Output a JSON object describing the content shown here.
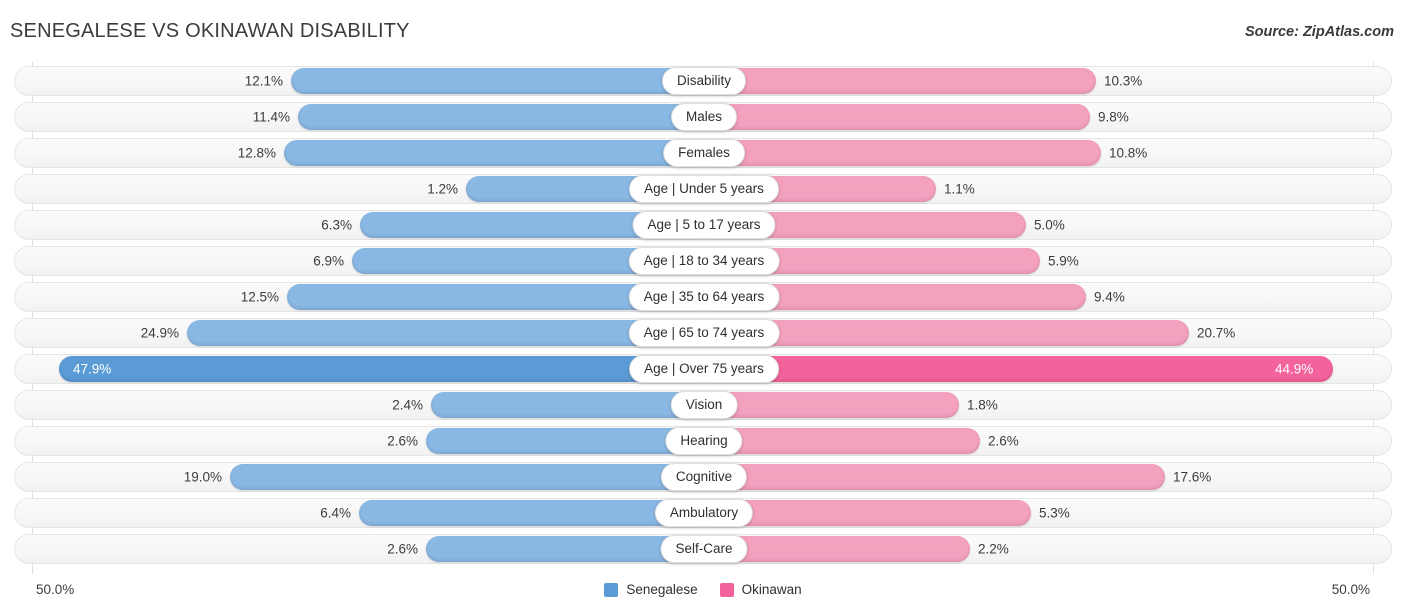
{
  "header": {
    "title": "SENEGALESE VS OKINAWAN DISABILITY",
    "source": "Source: ZipAtlas.com"
  },
  "axis": {
    "left_tick": "50.0%",
    "right_tick": "50.0%",
    "max": 50.0
  },
  "legend": {
    "items": [
      {
        "label": "Senegalese",
        "color": "#5b9bd5"
      },
      {
        "label": "Okinawan",
        "color": "#f4629c"
      }
    ]
  },
  "colors": {
    "left_light": "#8ab8e4",
    "left_dark": "#5b9bd5",
    "right_light": "#f4a0bf",
    "right_dark": "#f4629c",
    "row_bg": "#f7f7f7",
    "text": "#3c3c3c"
  },
  "chart_data": {
    "type": "bar",
    "title": "SENEGALESE VS OKINAWAN DISABILITY",
    "subtitle": "Source: ZipAtlas.com",
    "orientation": "horizontal-diverging",
    "xlabel": "",
    "ylabel": "",
    "xlim": [
      -50.0,
      50.0
    ],
    "grid": false,
    "legend_position": "bottom-center",
    "categories": [
      "Disability",
      "Males",
      "Females",
      "Age | Under 5 years",
      "Age | 5 to 17 years",
      "Age | 18 to 34 years",
      "Age | 35 to 64 years",
      "Age | 65 to 74 years",
      "Age | Over 75 years",
      "Vision",
      "Hearing",
      "Cognitive",
      "Ambulatory",
      "Self-Care"
    ],
    "series": [
      {
        "name": "Senegalese",
        "values": [
          12.1,
          11.4,
          12.8,
          1.2,
          6.3,
          6.9,
          12.5,
          24.9,
          47.9,
          2.4,
          2.6,
          19.0,
          6.4,
          2.6
        ],
        "labels": [
          "12.1%",
          "11.4%",
          "12.8%",
          "1.2%",
          "6.3%",
          "6.9%",
          "12.5%",
          "24.9%",
          "47.9%",
          "2.4%",
          "2.6%",
          "19.0%",
          "6.4%",
          "2.6%"
        ]
      },
      {
        "name": "Okinawan",
        "values": [
          10.3,
          9.8,
          10.8,
          1.1,
          5.0,
          5.9,
          9.4,
          20.7,
          44.9,
          1.8,
          2.6,
          17.6,
          5.3,
          2.2
        ],
        "labels": [
          "10.3%",
          "9.8%",
          "10.8%",
          "1.1%",
          "5.0%",
          "5.9%",
          "9.4%",
          "20.7%",
          "44.9%",
          "1.8%",
          "2.6%",
          "17.6%",
          "5.3%",
          "2.2%"
        ]
      }
    ]
  },
  "rows": [
    {
      "label": "Disability",
      "left": "12.1%",
      "right": "10.3%",
      "left_val": 12.1,
      "right_val": 10.3,
      "highlight": false
    },
    {
      "label": "Males",
      "left": "11.4%",
      "right": "9.8%",
      "left_val": 11.4,
      "right_val": 9.8,
      "highlight": false
    },
    {
      "label": "Females",
      "left": "12.8%",
      "right": "10.8%",
      "left_val": 12.8,
      "right_val": 10.8,
      "highlight": false
    },
    {
      "label": "Age | Under 5 years",
      "left": "1.2%",
      "right": "1.1%",
      "left_val": 1.2,
      "right_val": 1.1,
      "highlight": false
    },
    {
      "label": "Age | 5 to 17 years",
      "left": "6.3%",
      "right": "5.0%",
      "left_val": 6.3,
      "right_val": 5.0,
      "highlight": false
    },
    {
      "label": "Age | 18 to 34 years",
      "left": "6.9%",
      "right": "5.9%",
      "left_val": 6.9,
      "right_val": 5.9,
      "highlight": false
    },
    {
      "label": "Age | 35 to 64 years",
      "left": "12.5%",
      "right": "9.4%",
      "left_val": 12.5,
      "right_val": 9.4,
      "highlight": false
    },
    {
      "label": "Age | 65 to 74 years",
      "left": "24.9%",
      "right": "20.7%",
      "left_val": 24.9,
      "right_val": 20.7,
      "highlight": false
    },
    {
      "label": "Age | Over 75 years",
      "left": "47.9%",
      "right": "44.9%",
      "left_val": 47.9,
      "right_val": 44.9,
      "highlight": true
    },
    {
      "label": "Vision",
      "left": "2.4%",
      "right": "1.8%",
      "left_val": 2.4,
      "right_val": 1.8,
      "highlight": false
    },
    {
      "label": "Hearing",
      "left": "2.6%",
      "right": "2.6%",
      "left_val": 2.6,
      "right_val": 2.6,
      "highlight": false
    },
    {
      "label": "Cognitive",
      "left": "19.0%",
      "right": "17.6%",
      "left_val": 19.0,
      "right_val": 17.6,
      "highlight": false
    },
    {
      "label": "Ambulatory",
      "left": "6.4%",
      "right": "5.3%",
      "left_val": 6.4,
      "right_val": 5.3,
      "highlight": false
    },
    {
      "label": "Self-Care",
      "left": "2.6%",
      "right": "2.2%",
      "left_val": 2.6,
      "right_val": 2.2,
      "highlight": false
    }
  ]
}
